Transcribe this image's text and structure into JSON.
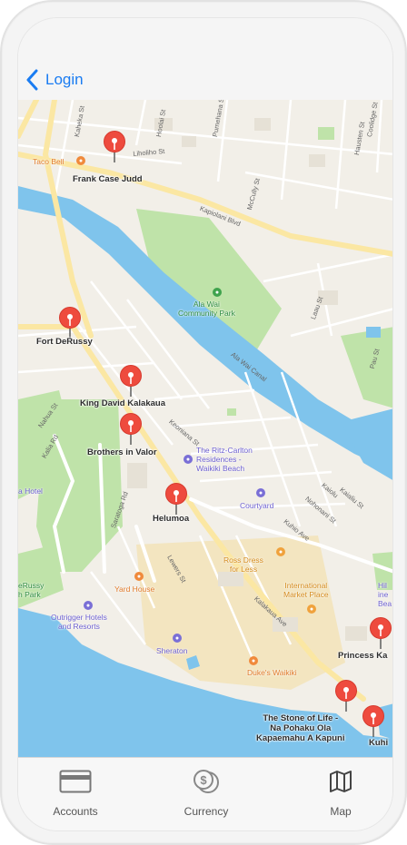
{
  "nav": {
    "back_label": "Login"
  },
  "map": {
    "pins": [
      {
        "label": "Frank Case Judd"
      },
      {
        "label": "Fort DeRussy"
      },
      {
        "label": "King David Kalakaua"
      },
      {
        "label": "Brothers in Valor"
      },
      {
        "label": "Helumoa"
      },
      {
        "label": "Princess Ka"
      },
      {
        "label": "The Stone of Life -\nNa Pohaku Ola\nKapaemahu A Kapuni"
      },
      {
        "label": "Kuhi"
      }
    ],
    "places": {
      "taco_bell": "Taco Bell",
      "ala_wai_park": "Ala Wai\nCommunity Park",
      "ritz": "The Ritz-Carlton\nResidences - \nWaikiki Beach",
      "courtyard": "Courtyard",
      "ross": "Ross Dress\nfor Less",
      "intl_market": "International\nMarket Place",
      "yard_house": "Yard House",
      "outrigger": "Outrigger Hotels\nand Resorts",
      "sheraton": "Sheraton",
      "dukes": "Duke's Waikiki",
      "hotel_left": "a Hotel",
      "russy_park": "eRussy\nh Park",
      "hilton_right": "Hil\nine\nBea"
    },
    "streets": {
      "kapiolani": "Kapiolani Blvd",
      "ala_wai_canal": "Ala Wai Canal",
      "kalakaua": "Kalakaua Ave",
      "kuhio": "Kuhio Ave",
      "saratoga": "Saratoga Rd",
      "lewers": "Lewers St",
      "nahua": "Nahua St",
      "kaiolu": "Kaiolu St",
      "nohonani": "Nohonani St",
      "kalaimoku": "Kalaimoku St",
      "pau": "Pau St",
      "keoniana": "Keoniana St",
      "laau": "Laau St",
      "mccully": "McCully St",
      "hoolai": "Hoolai St",
      "pumehana": "Pumehana St",
      "kaheka": "Kaheka St",
      "kaialiu": "Kaialiu St",
      "kaiolu2": "Kaiolu",
      "kalia": "Kalia Rd",
      "liholiho": "Liholiho St",
      "hausten": "Hausten St",
      "coolidge": "Coolidge St"
    }
  },
  "tabs": [
    {
      "label": "Accounts",
      "icon": "credit-card-icon"
    },
    {
      "label": "Currency",
      "icon": "coins-icon"
    },
    {
      "label": "Map",
      "icon": "map-icon"
    }
  ],
  "colors": {
    "accent": "#1a7cf2",
    "pin": "#ee4b3e",
    "water": "#7fc4ec",
    "park": "#bfe3a9",
    "sand": "#f3e5c0",
    "road_major": "#fbe7a3",
    "land": "#f2efe8"
  }
}
